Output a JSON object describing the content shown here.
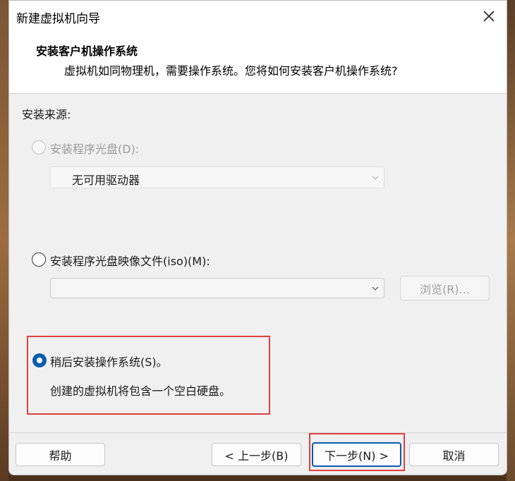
{
  "window": {
    "title": "新建虚拟机向导"
  },
  "header": {
    "title": "安装客户机操作系统",
    "subtitle": "虚拟机如同物理机，需要操作系统。您将如何安装客户机操作系统?"
  },
  "install_source": {
    "label": "安装来源:",
    "options": [
      {
        "label": "安装程序光盘(D):",
        "selected": false,
        "enabled": false,
        "dropdown_value": "无可用驱动器"
      },
      {
        "label": "安装程序光盘映像文件(iso)(M):",
        "selected": false,
        "enabled": true,
        "dropdown_value": "",
        "browse_label": "浏览(R)..."
      },
      {
        "label": "稍后安装操作系统(S)。",
        "selected": true,
        "enabled": true,
        "description": "创建的虚拟机将包含一个空白硬盘。"
      }
    ]
  },
  "footer": {
    "help_label": "帮助",
    "back_label": "< 上一步(B)",
    "next_label": "下一步(N) >",
    "cancel_label": "取消"
  },
  "colors": {
    "accent": "#0b5cad",
    "highlight_box": "#e04040"
  },
  "icons": {
    "close": "close-icon",
    "dropdown": "chevron-down-icon"
  }
}
